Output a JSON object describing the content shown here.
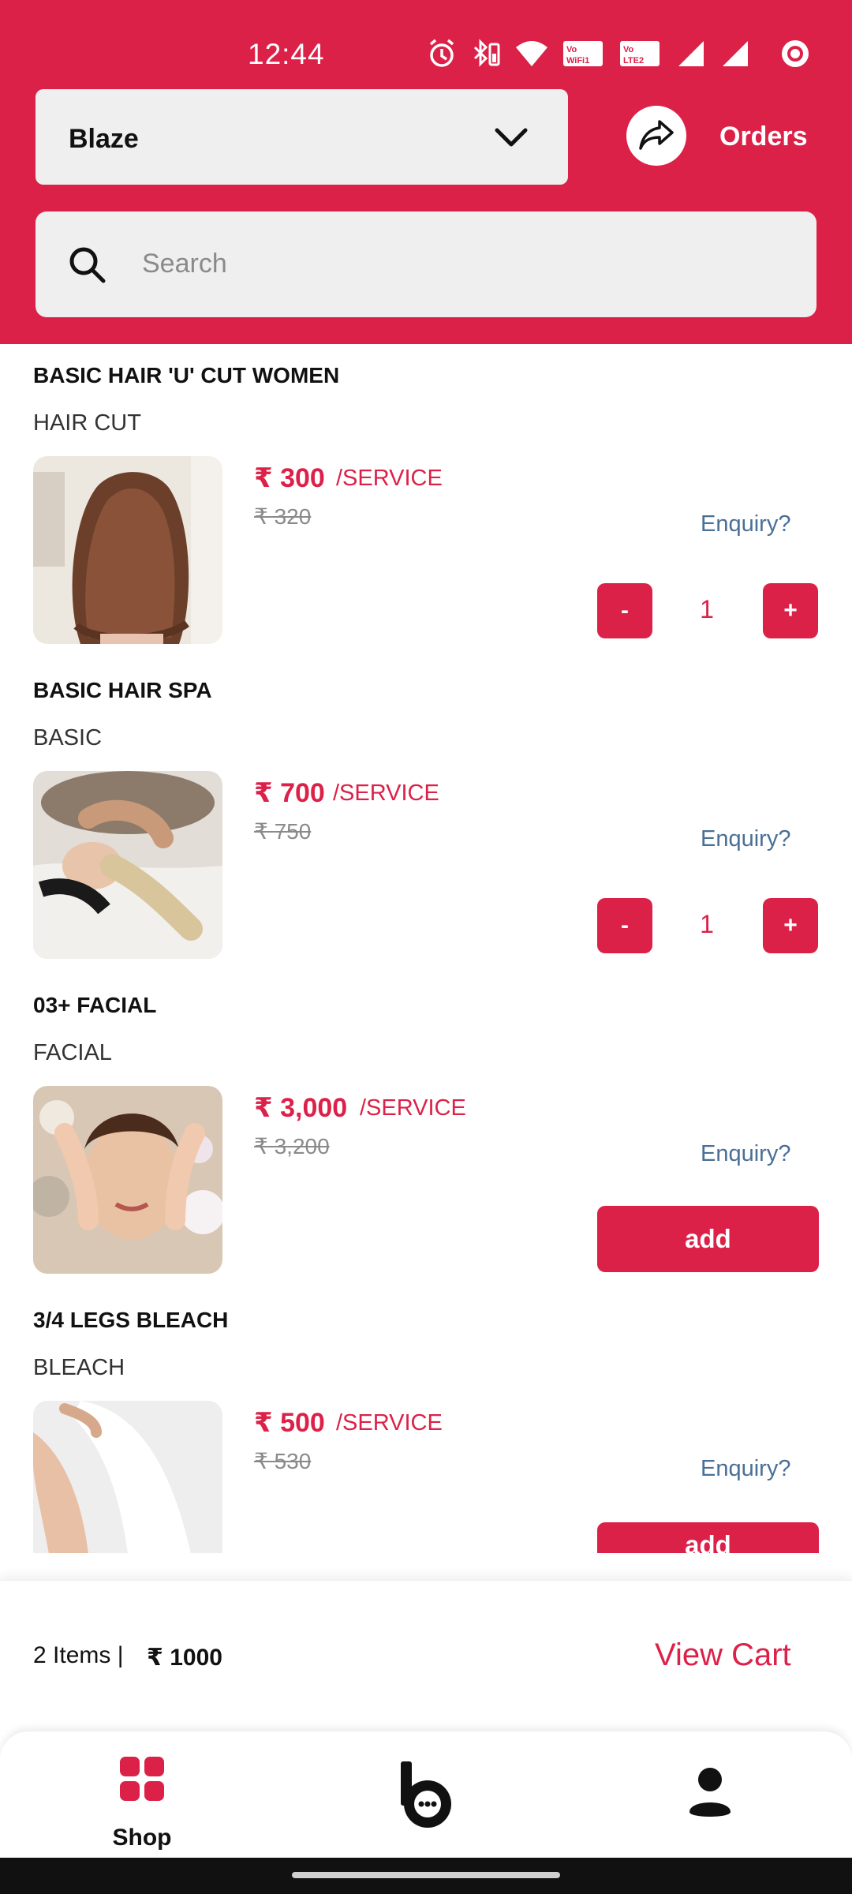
{
  "status_bar": {
    "time": "12:44"
  },
  "header": {
    "store_name": "Blaze",
    "orders_label": "Orders",
    "search_placeholder": "Search"
  },
  "items": [
    {
      "title": "BASIC HAIR 'U' CUT WOMEN",
      "category": "HAIR CUT",
      "price": "₹ 300",
      "unit": "/SERVICE",
      "mrp": "₹ 320",
      "enquiry": "Enquiry?",
      "quantity": "1",
      "minus": "-",
      "plus": "+"
    },
    {
      "title": "BASIC HAIR SPA",
      "category": "BASIC",
      "price": "₹ 700",
      "unit": "/SERVICE",
      "mrp": "₹ 750",
      "enquiry": "Enquiry?",
      "quantity": "1",
      "minus": "-",
      "plus": "+"
    },
    {
      "title": "03+ FACIAL",
      "category": "FACIAL",
      "price": "₹ 3,000",
      "unit": "/SERVICE",
      "mrp": "₹ 3,200",
      "enquiry": "Enquiry?",
      "add_label": "add"
    },
    {
      "title": "3/4 LEGS BLEACH",
      "category": "BLEACH",
      "price": "₹ 500",
      "unit": "/SERVICE",
      "mrp": "₹ 530",
      "enquiry": "Enquiry?",
      "add_label": "add"
    }
  ],
  "cart": {
    "count": "2 Items  |",
    "total": "₹ 1000",
    "view_cart": "View Cart"
  },
  "bottom_nav": {
    "shop_label": "Shop"
  },
  "colors": {
    "brand": "#dc2149",
    "link": "#4a6f96"
  }
}
